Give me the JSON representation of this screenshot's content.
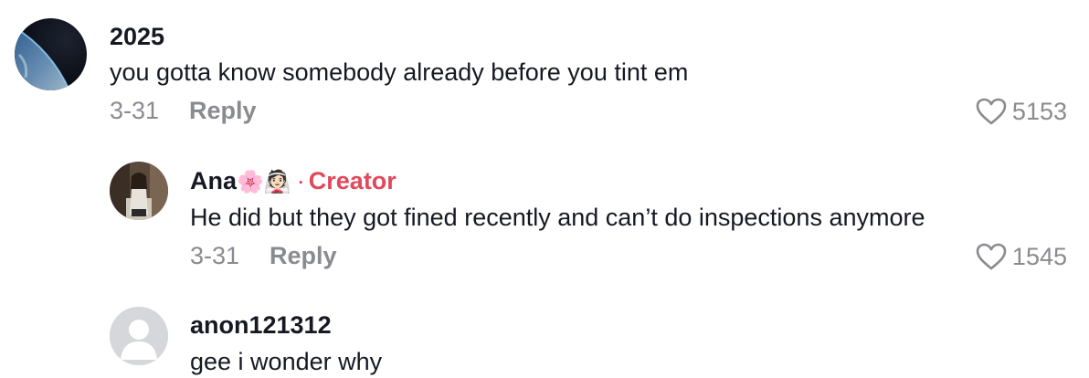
{
  "comments": [
    {
      "username": "2025",
      "text": "you gotta know somebody already before you tint em",
      "date": "3-31",
      "reply_label": "Reply",
      "likes": "5153",
      "avatar": "earth-from-space-avatar"
    },
    {
      "username": "Ana",
      "emojis": "🌸👰🏻",
      "creator_separator": "·",
      "creator_label": "Creator",
      "text": "He did but they got fined recently and can’t do inspections anymore",
      "date": "3-31",
      "reply_label": "Reply",
      "likes": "1545",
      "avatar": "profile-photo-avatar"
    },
    {
      "username": "anon121312",
      "text": "gee i wonder why",
      "avatar": "default-user-avatar"
    }
  ],
  "colors": {
    "text": "#161823",
    "muted": "#8a8b91",
    "creator": "#e2485c"
  }
}
